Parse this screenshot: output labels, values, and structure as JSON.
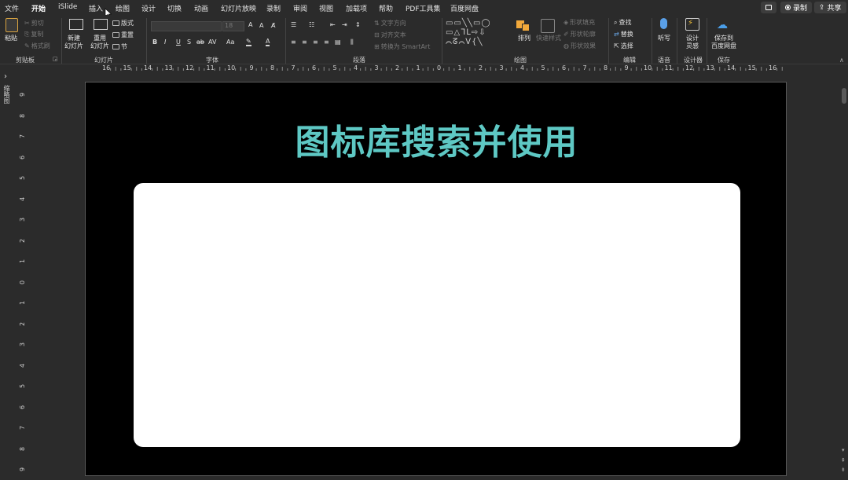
{
  "menu": {
    "items": [
      "文件",
      "开始",
      "iSlide",
      "插入",
      "绘图",
      "设计",
      "切换",
      "动画",
      "幻灯片放映",
      "录制",
      "审阅",
      "视图",
      "加载项",
      "帮助",
      "PDF工具集",
      "百度网盘"
    ],
    "active": "开始",
    "record_label": "录制",
    "share_label": "共享"
  },
  "ribbon": {
    "clipboard": {
      "paste": "粘贴",
      "cut": "剪切",
      "copy": "复制",
      "format_painter": "格式刷",
      "group": "剪贴板"
    },
    "slides": {
      "new_slide": "新建\n幻灯片",
      "reuse_slide": "重用\n幻灯片",
      "layout": "版式",
      "reset": "重置",
      "section": "节",
      "group": "幻灯片"
    },
    "font": {
      "font_size": "18",
      "group": "字体",
      "bold": "B",
      "italic": "I",
      "underline": "U",
      "shadow": "S",
      "strike": "ab",
      "spacing": "AV",
      "case": "Aa",
      "grow": "A",
      "shrink": "A"
    },
    "paragraph": {
      "text_direction": "文字方向",
      "align_text": "对齐文本",
      "smartart": "转换为 SmartArt",
      "group": "段落"
    },
    "drawing": {
      "arrange": "排列",
      "quick_styles": "快速样式",
      "shape_fill": "形状填充",
      "shape_outline": "形状轮廓",
      "shape_effects": "形状效果",
      "group": "绘图"
    },
    "editing": {
      "find": "查找",
      "replace": "替换",
      "select": "选择",
      "group": "编辑"
    },
    "voice": {
      "dictate": "听写",
      "group": "语音"
    },
    "designer": {
      "design_ideas": "设计\n灵感",
      "group": "设计器"
    },
    "save": {
      "save_to_baidu": "保存到\n百度网盘",
      "group": "保存"
    }
  },
  "ruler": {
    "h_labels": [
      "16",
      "15",
      "14",
      "13",
      "12",
      "11",
      "10",
      "9",
      "8",
      "7",
      "6",
      "5",
      "4",
      "3",
      "2",
      "1",
      "0",
      "1",
      "2",
      "3",
      "4",
      "5",
      "6",
      "7",
      "8",
      "9",
      "10",
      "11",
      "12",
      "13",
      "14",
      "15",
      "16"
    ],
    "v_labels": [
      "9",
      "8",
      "7",
      "6",
      "5",
      "4",
      "3",
      "2",
      "1",
      "0",
      "1",
      "2",
      "3",
      "4",
      "5",
      "6",
      "7",
      "8",
      "9"
    ]
  },
  "thumb_label": "缩略图",
  "slide": {
    "title": "图标库搜索并使用"
  },
  "colors": {
    "title": "#5ec8c4",
    "slide_bg": "#000000",
    "card": "#ffffff",
    "ui_bg": "#2b2b2b"
  }
}
